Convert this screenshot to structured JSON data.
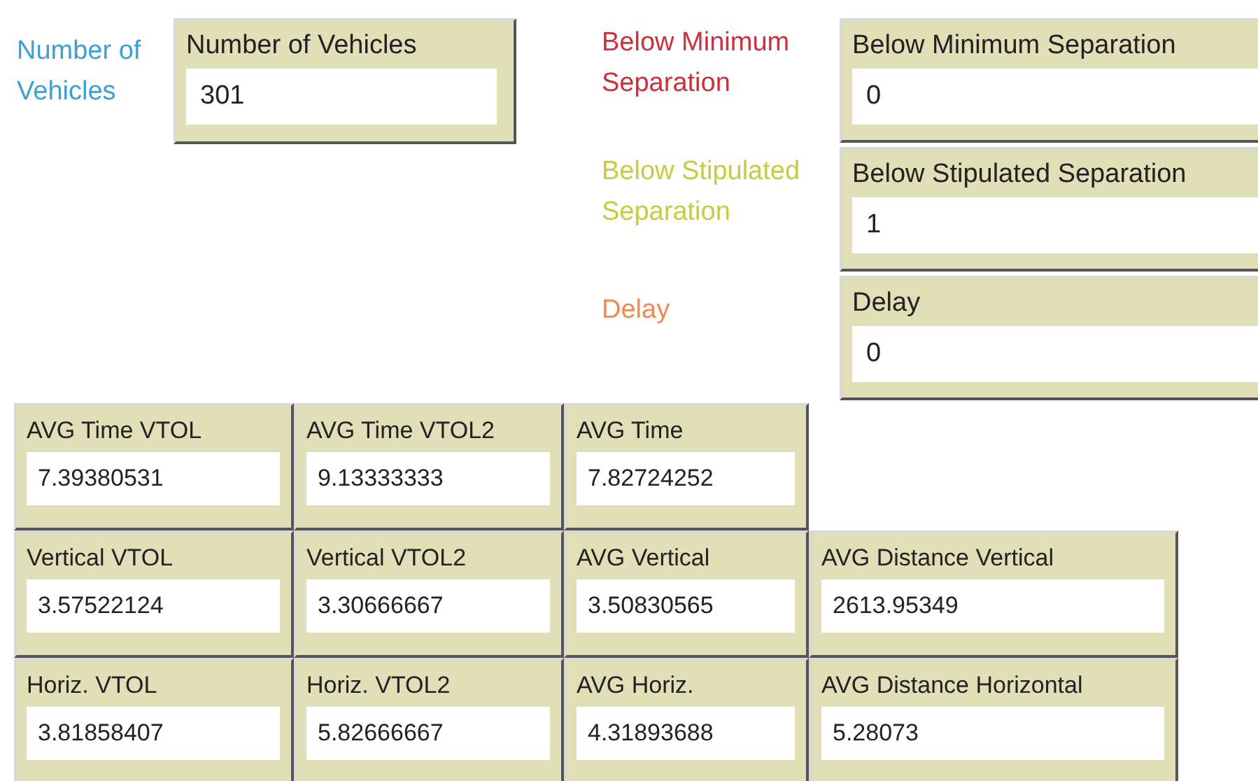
{
  "top_left": {
    "note": {
      "text": "Number of Vehicles",
      "color": "#3d9fd3"
    },
    "monitor": {
      "title": "Number of Vehicles",
      "value": "301"
    }
  },
  "right_column": [
    {
      "note": {
        "text": "Below Minimum Separation",
        "color": "#c8323c"
      },
      "monitor": {
        "title": "Below Minimum Separation",
        "value": "0"
      }
    },
    {
      "note": {
        "text": "Below Stipulated Separation",
        "color": "#c4cc44"
      },
      "monitor": {
        "title": "Below Stipulated Separation",
        "value": "1"
      }
    },
    {
      "note": {
        "text": "Delay",
        "color": "#f08a50"
      },
      "monitor": {
        "title": "Delay",
        "value": "0"
      }
    }
  ],
  "monitor_rows": [
    [
      {
        "title": "AVG Time VTOL",
        "value": "7.39380531"
      },
      {
        "title": "AVG Time VTOL2",
        "value": "9.13333333"
      },
      {
        "title": "AVG Time",
        "value": "7.82724252"
      }
    ],
    [
      {
        "title": "Vertical VTOL",
        "value": "3.57522124"
      },
      {
        "title": "Vertical VTOL2",
        "value": "3.30666667"
      },
      {
        "title": "AVG Vertical",
        "value": "3.50830565"
      },
      {
        "title": "AVG Distance Vertical",
        "value": "2613.95349"
      }
    ],
    [
      {
        "title": "Horiz. VTOL",
        "value": "3.81858407"
      },
      {
        "title": "Horiz.  VTOL2",
        "value": "5.82666667"
      },
      {
        "title": "AVG Horiz.",
        "value": "4.31893688"
      },
      {
        "title": "AVG Distance Horizontal",
        "value": "5.28073"
      }
    ]
  ]
}
